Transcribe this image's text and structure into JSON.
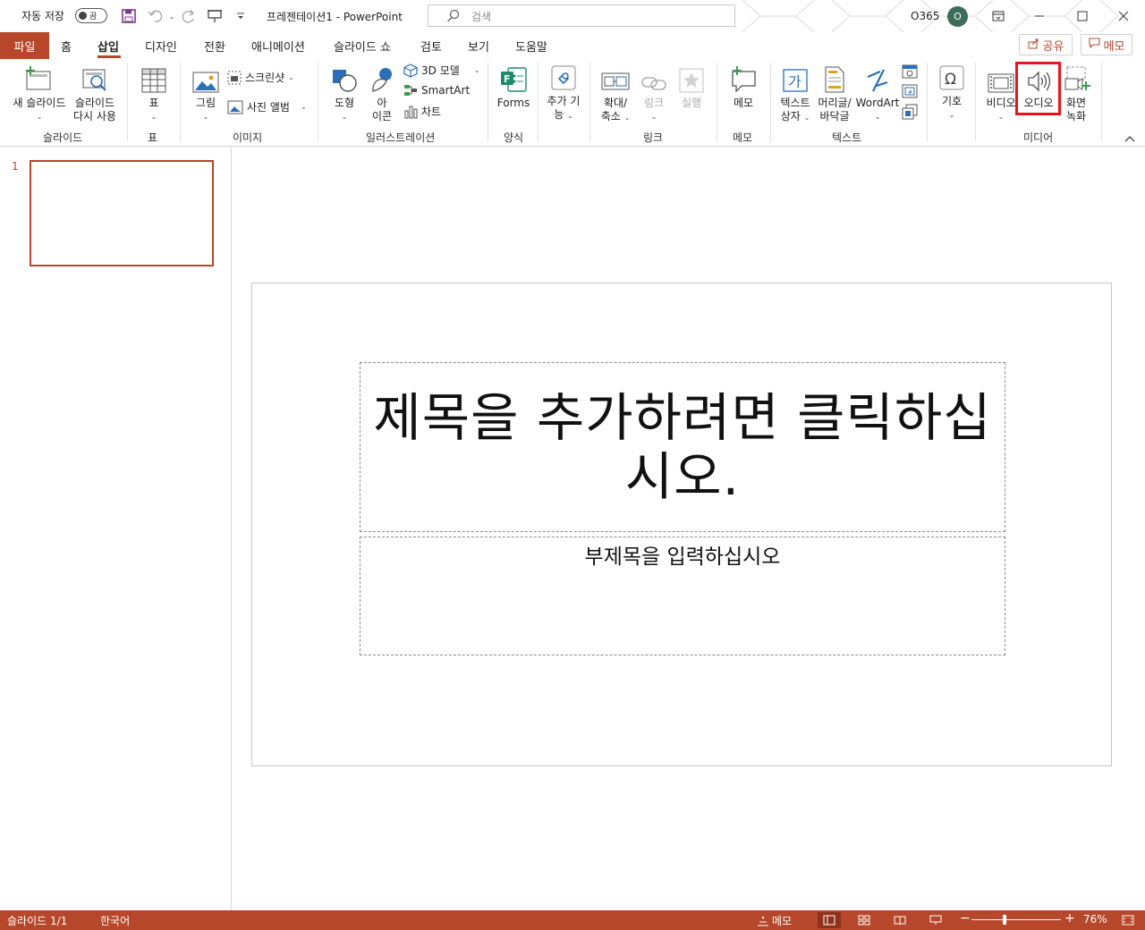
{
  "titlebar": {
    "autosave_label": "자동 저장",
    "autosave_state": "끔",
    "doc_title": "프레젠테이션1  -  PowerPoint",
    "search_placeholder": "검색",
    "account": "O365",
    "avatar_initial": "O"
  },
  "tabs": [
    {
      "label": "파일"
    },
    {
      "label": "홈"
    },
    {
      "label": "삽입"
    },
    {
      "label": "디자인"
    },
    {
      "label": "전환"
    },
    {
      "label": "애니메이션"
    },
    {
      "label": "슬라이드 쇼"
    },
    {
      "label": "검토"
    },
    {
      "label": "보기"
    },
    {
      "label": "도움말"
    }
  ],
  "share_label": "공유",
  "comments_label": "메모",
  "ribbon": {
    "new_slide": [
      "새 슬라이드",
      ""
    ],
    "reuse_slides": [
      "슬라이드",
      "다시 사용"
    ],
    "table": "표",
    "picture": "그림",
    "screenshot": "스크린샷",
    "photo_album": "사진 앨범",
    "shapes": "도형",
    "icons": [
      "아",
      "이콘"
    ],
    "model3d": "3D 모델",
    "smartart": "SmartArt",
    "chart": "차트",
    "forms": "Forms",
    "addins": [
      "추가 기",
      "능"
    ],
    "zoom": [
      "확대/",
      "축소"
    ],
    "link": "링크",
    "action": "실행",
    "comment": "메모",
    "textbox": [
      "텍스트",
      "상자"
    ],
    "header_footer": [
      "머리글/",
      "바닥글"
    ],
    "wordart": "WordArt",
    "symbols": "기호",
    "video": "비디오",
    "audio": "오디오",
    "screen_recording": [
      "화면",
      "녹화"
    ],
    "groups": {
      "slides": "슬라이드",
      "tables": "표",
      "images": "이미지",
      "illustrations": "일러스트레이션",
      "forms": "양식",
      "links": "링크",
      "comments": "메모",
      "text": "텍스트",
      "media": "미디어"
    }
  },
  "slides_pane": {
    "slide_number": "1"
  },
  "slide": {
    "title_placeholder": "제목을 추가하려면 클릭하십시오.",
    "subtitle_placeholder": "부제목을 입력하십시오"
  },
  "statusbar": {
    "slide_info": "슬라이드 1/1",
    "language": "한국어",
    "notes": "메모",
    "zoom_minus": "−",
    "zoom_plus": "+",
    "zoom_level": "76%"
  },
  "colors": {
    "accent": "#b7472a",
    "highlight": "#e8141c"
  }
}
